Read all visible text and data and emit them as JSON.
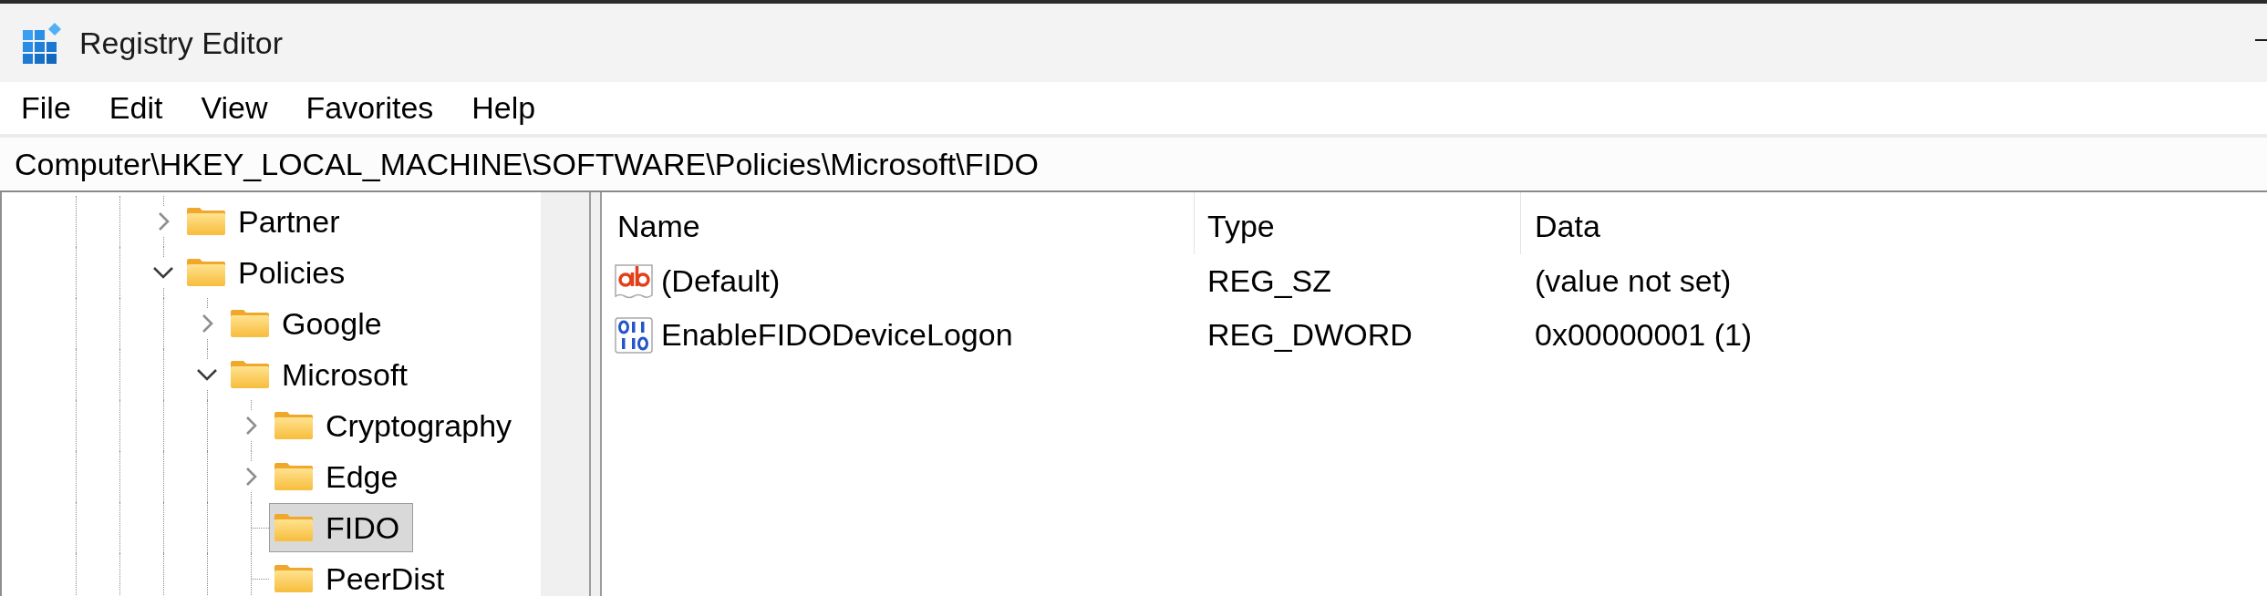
{
  "window": {
    "title": "Registry Editor"
  },
  "menu": [
    "File",
    "Edit",
    "View",
    "Favorites",
    "Help"
  ],
  "address_bar": {
    "value": "Computer\\HKEY_LOCAL_MACHINE\\SOFTWARE\\Policies\\Microsoft\\FIDO"
  },
  "tree": {
    "items": [
      {
        "label": "Partner",
        "expanded": false,
        "selected": false
      },
      {
        "label": "Policies",
        "expanded": true,
        "selected": false,
        "children": [
          {
            "label": "Google",
            "expanded": false,
            "selected": false
          },
          {
            "label": "Microsoft",
            "expanded": true,
            "selected": false,
            "children": [
              {
                "label": "Cryptography",
                "expanded": false,
                "selected": false
              },
              {
                "label": "Edge",
                "expanded": false,
                "selected": false
              },
              {
                "label": "FIDO",
                "selected": true
              },
              {
                "label": "PeerDist",
                "selected": false
              }
            ]
          }
        ]
      }
    ]
  },
  "values": {
    "columns": [
      "Name",
      "Type",
      "Data"
    ],
    "rows": [
      {
        "kind": "string",
        "name": "(Default)",
        "type": "REG_SZ",
        "data": "(value not set)"
      },
      {
        "kind": "dword",
        "name": "EnableFIDODeviceLogon",
        "type": "REG_DWORD",
        "data": "0x00000001 (1)"
      }
    ]
  }
}
